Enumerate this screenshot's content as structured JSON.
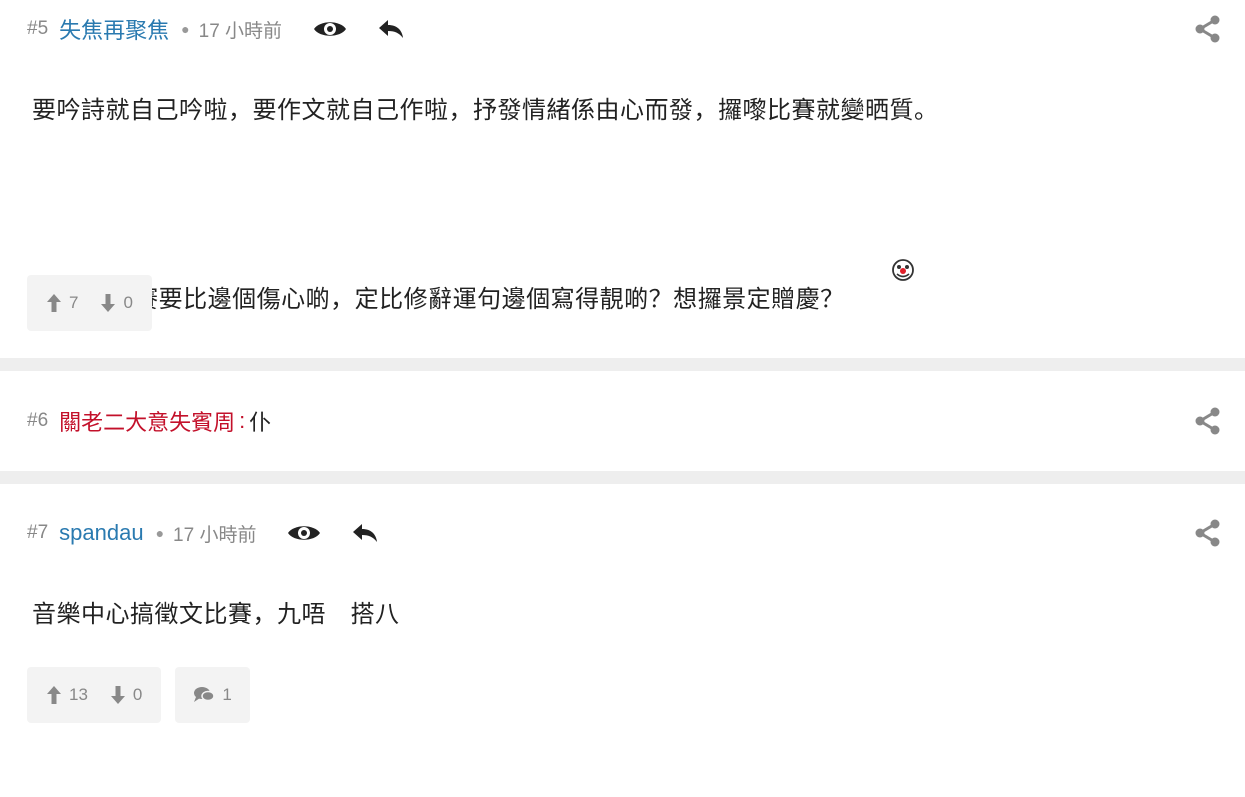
{
  "posts": [
    {
      "floor": "#5",
      "author": "失焦再聚焦",
      "time": "17 小時前",
      "lines": [
        "要吟詩就自己吟啦，要作文就自己作啦，抒發情緒係由心而發，攞嚟比賽就變晒質。",
        "你搞比賽要比邊個傷心啲，定比修辭運句邊個寫得靚啲？想攞景定贈慶？"
      ],
      "upvotes": "7",
      "downvotes": "0"
    },
    {
      "floor": "#6",
      "author": "關老二大意失賓周",
      "text": "仆"
    },
    {
      "floor": "#7",
      "author": "spandau",
      "time": "17 小時前",
      "lines": [
        "音樂中心搞徵文比賽，九唔　搭八"
      ],
      "upvotes": "13",
      "downvotes": "0",
      "comments": "1"
    }
  ],
  "icons": {
    "view": "eye-icon",
    "reply": "reply-icon",
    "share": "share-icon",
    "up": "thumb-up-arrow-icon",
    "down": "thumb-down-arrow-icon",
    "comment": "comment-icon",
    "emoji": "clown-emoji-icon"
  },
  "colors": {
    "author_link": "#2a7ab0",
    "author_highlight": "#c3102a",
    "muted": "#888888",
    "divider": "#eeeeee",
    "vote_bg": "#f3f3f3"
  }
}
